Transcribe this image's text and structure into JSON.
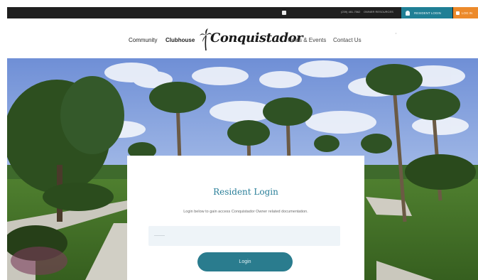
{
  "topbar": {
    "phone": "(239) 481-7562",
    "owner_link": "OWNER RESOURCES",
    "resident_login_label": "RESIDENT LOGIN",
    "orange_label": "LOG IN"
  },
  "nav": {
    "community": "Community",
    "clubhouse": "Clubhouse",
    "logo_text": "Conquistador",
    "news": "News & Events",
    "contact": "Contact Us"
  },
  "login": {
    "title": "Resident Login",
    "subtitle": "Login below to gain access Conquistador Owner related documentation.",
    "password_placeholder": "———",
    "button_label": "Login"
  },
  "colors": {
    "accent": "#2a7c8e",
    "topbar": "#1f1f1f",
    "orange": "#ec8a2b"
  },
  "icons": [
    "user-icon",
    "palm-logo-icon",
    "square-icon"
  ]
}
